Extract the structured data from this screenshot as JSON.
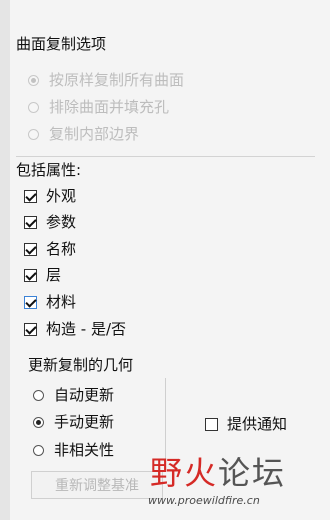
{
  "surface_copy": {
    "title": "曲面复制选项",
    "options": [
      {
        "label": "按原样复制所有曲面",
        "selected": true,
        "enabled": false
      },
      {
        "label": "排除曲面并填充孔",
        "selected": false,
        "enabled": false
      },
      {
        "label": "复制内部边界",
        "selected": false,
        "enabled": false
      }
    ]
  },
  "properties": {
    "title": "包括属性:",
    "items": [
      {
        "label": "外观",
        "checked": true,
        "focused": false
      },
      {
        "label": "参数",
        "checked": true,
        "focused": false
      },
      {
        "label": "名称",
        "checked": true,
        "focused": false
      },
      {
        "label": "层",
        "checked": true,
        "focused": false
      },
      {
        "label": "材料",
        "checked": true,
        "focused": true
      },
      {
        "label": "构造 - 是/否",
        "checked": true,
        "focused": false
      }
    ]
  },
  "update_geometry": {
    "title": "更新复制的几何",
    "options": [
      {
        "label": "自动更新",
        "selected": false
      },
      {
        "label": "手动更新",
        "selected": true
      },
      {
        "label": "非相关性",
        "selected": false
      }
    ],
    "notify_label": "提供通知",
    "notify_checked": false,
    "regen_button_label": "重新调整基准"
  },
  "watermark": {
    "text_red": "野火",
    "text_gray": "论坛",
    "url": "www.proewildfire.cn"
  },
  "colors": {
    "background": "#f4f4f4",
    "disabled_text": "#bdbdbd",
    "focus_blue": "#3b82d6",
    "watermark_red": "#d52a26"
  }
}
